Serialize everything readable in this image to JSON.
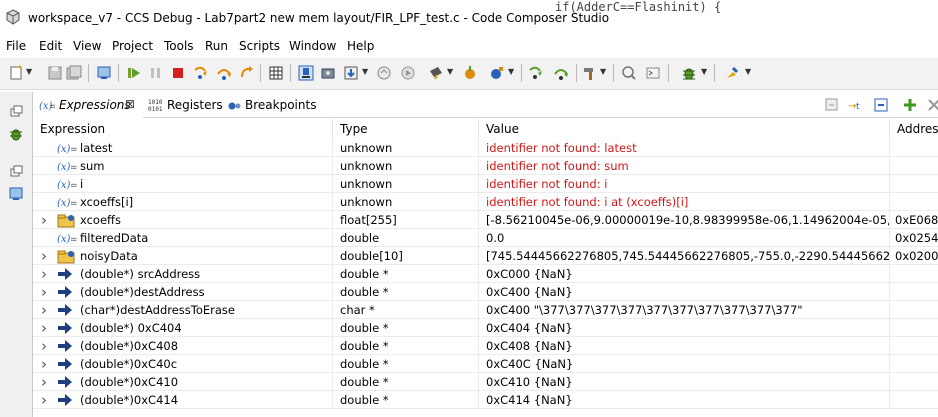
{
  "window": {
    "title": "workspace_v7 - CCS Debug - Lab7part2 new mem layout/FIR_LPF_test.c - Code Composer Studio",
    "behind_text": "if(AdderC==Flashinit) {"
  },
  "menu": [
    "File",
    "Edit",
    "View",
    "Project",
    "Tools",
    "Run",
    "Scripts",
    "Window",
    "Help"
  ],
  "tabs": [
    {
      "label": "Expressions",
      "icon": "expressions-icon",
      "active": true,
      "close": "⊠"
    },
    {
      "label": "Registers",
      "icon": "registers-icon",
      "active": false
    },
    {
      "label": "Breakpoints",
      "icon": "breakpoints-icon",
      "active": false
    }
  ],
  "columns": [
    "Expression",
    "Type",
    "Value",
    "Address"
  ],
  "rows": [
    {
      "expand": false,
      "icon": "variable",
      "name": "latest",
      "type": "unknown",
      "value": "identifier not found: latest",
      "error": true,
      "address": ""
    },
    {
      "expand": false,
      "icon": "variable",
      "name": "sum",
      "type": "unknown",
      "value": "identifier not found: sum",
      "error": true,
      "address": ""
    },
    {
      "expand": false,
      "icon": "variable",
      "name": "i",
      "type": "unknown",
      "value": "identifier not found: i",
      "error": true,
      "address": ""
    },
    {
      "expand": false,
      "icon": "variable",
      "name": "xcoeffs[i]",
      "type": "unknown",
      "value": "identifier not found: i at (xcoeffs)[i]",
      "error": true,
      "address": ""
    },
    {
      "expand": true,
      "icon": "array",
      "name": "xcoeffs",
      "type": "float[255]",
      "value": "[-8.56210045e-06,9.00000019e-10,8.98399958e-06,1.14962004e-05,6.7627997...",
      "error": false,
      "address": "0xE068"
    },
    {
      "expand": false,
      "icon": "variable",
      "name": "filteredData",
      "type": "double",
      "value": "0.0",
      "error": false,
      "address": "0x0254"
    },
    {
      "expand": true,
      "icon": "array",
      "name": "noisyData",
      "type": "double[10]",
      "value": "[745.54445662276805,745.54445662276805,-755.0,-2290.5444566227702,-230...",
      "error": false,
      "address": "0x0200"
    },
    {
      "expand": true,
      "icon": "pointer",
      "name": "(double*) srcAddress",
      "type": "double *",
      "value": "0xC000 {NaN}",
      "error": false,
      "address": ""
    },
    {
      "expand": true,
      "icon": "pointer",
      "name": "(double*)destAddress",
      "type": "double *",
      "value": "0xC400 {NaN}",
      "error": false,
      "address": ""
    },
    {
      "expand": true,
      "icon": "pointer",
      "name": "(char*)destAddressToErase",
      "type": "char *",
      "value": "0xC400 \"\\377\\377\\377\\377\\377\\377\\377\\377\\377\\377\"",
      "error": false,
      "address": ""
    },
    {
      "expand": true,
      "icon": "pointer",
      "name": "(double*) 0xC404",
      "type": "double *",
      "value": "0xC404 {NaN}",
      "error": false,
      "address": ""
    },
    {
      "expand": true,
      "icon": "pointer",
      "name": "(double*)0xC408",
      "type": "double *",
      "value": "0xC408 {NaN}",
      "error": false,
      "address": ""
    },
    {
      "expand": true,
      "icon": "pointer",
      "name": "(double*)0xC40c",
      "type": "double *",
      "value": "0xC40C {NaN}",
      "error": false,
      "address": ""
    },
    {
      "expand": true,
      "icon": "pointer",
      "name": "(double*)0xC410",
      "type": "double *",
      "value": "0xC410 {NaN}",
      "error": false,
      "address": ""
    },
    {
      "expand": true,
      "icon": "pointer",
      "name": "(double*)0xC414",
      "type": "double *",
      "value": "0xC414 {NaN}",
      "error": false,
      "address": ""
    }
  ],
  "colors": {
    "error": "#d01818",
    "accent": "#2a62b8",
    "toolbar_bg": "#f2f2f2"
  }
}
